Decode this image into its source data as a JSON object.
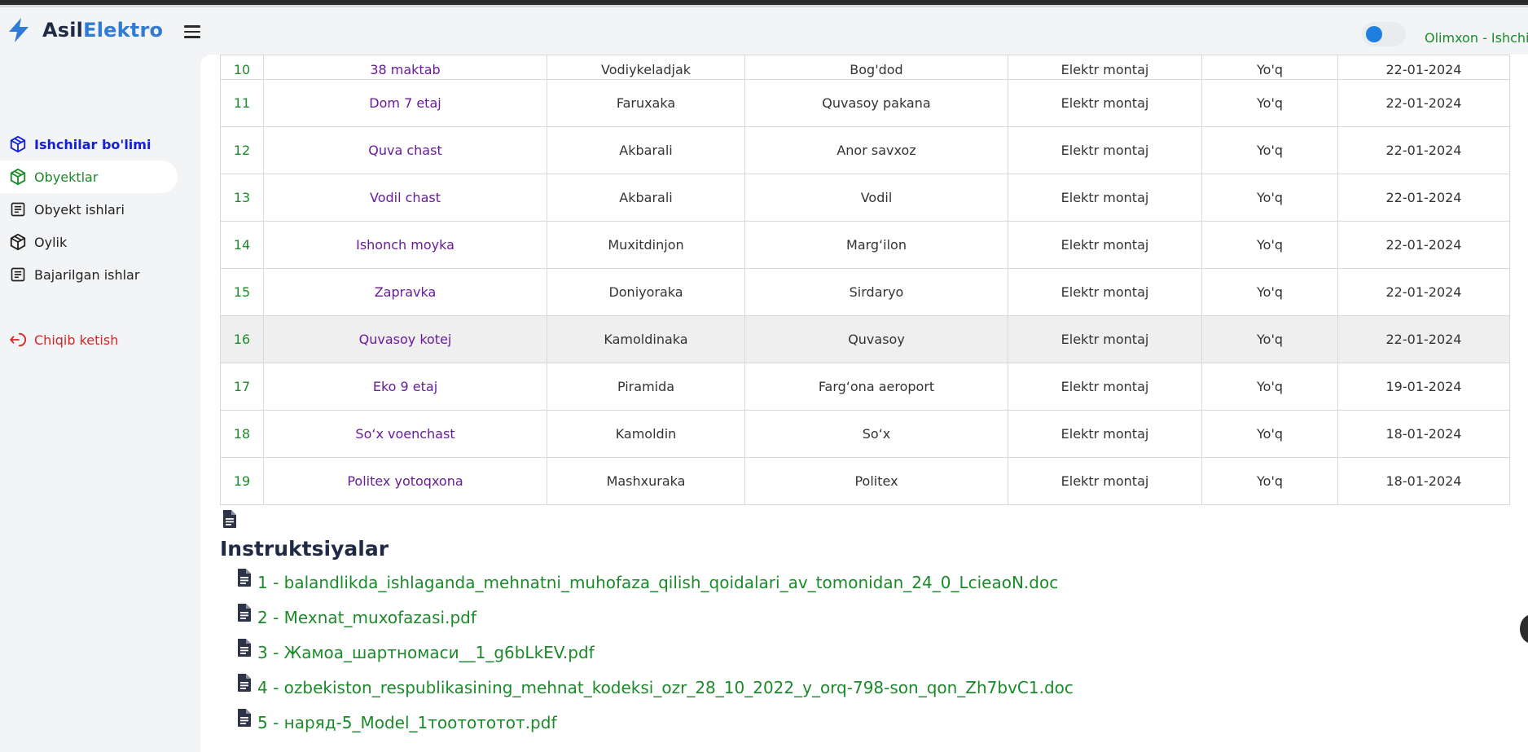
{
  "app": {
    "brand_part1": "Asil",
    "brand_part2": "Elektro"
  },
  "header": {
    "user_name": "Olimxon - Ishchi"
  },
  "sidebar": {
    "items": [
      {
        "label": "Ishchilar bo'limi",
        "icon": "box-icon"
      },
      {
        "label": "Obyektlar",
        "icon": "box-icon"
      },
      {
        "label": "Obyekt ishlari",
        "icon": "document-icon"
      },
      {
        "label": "Oylik",
        "icon": "box-icon"
      },
      {
        "label": "Bajarilgan ishlar",
        "icon": "document-icon"
      }
    ],
    "logout_label": "Chiqib ketish"
  },
  "table": {
    "rows": [
      {
        "num": "10",
        "name": "38 maktab",
        "worker": "Vodiykeladjak",
        "place": "Bog'dod",
        "type": "Elektr montaj",
        "status": "Yo'q",
        "date": "22-01-2024"
      },
      {
        "num": "11",
        "name": "Dom 7 etaj",
        "worker": "Faruxaka",
        "place": "Quvasoy pakana",
        "type": "Elektr montaj",
        "status": "Yo'q",
        "date": "22-01-2024"
      },
      {
        "num": "12",
        "name": "Quva chast",
        "worker": "Akbarali",
        "place": "Anor savxoz",
        "type": "Elektr montaj",
        "status": "Yo'q",
        "date": "22-01-2024"
      },
      {
        "num": "13",
        "name": "Vodil chast",
        "worker": "Akbarali",
        "place": "Vodil",
        "type": "Elektr montaj",
        "status": "Yo'q",
        "date": "22-01-2024"
      },
      {
        "num": "14",
        "name": "Ishonch moyka",
        "worker": "Muxitdinjon",
        "place": "Marg‘ilon",
        "type": "Elektr montaj",
        "status": "Yo'q",
        "date": "22-01-2024"
      },
      {
        "num": "15",
        "name": "Zapravka",
        "worker": "Doniyoraka",
        "place": "Sirdaryo",
        "type": "Elektr montaj",
        "status": "Yo'q",
        "date": "22-01-2024"
      },
      {
        "num": "16",
        "name": "Quvasoy kotej",
        "worker": "Kamoldinaka",
        "place": "Quvasoy",
        "type": "Elektr montaj",
        "status": "Yo'q",
        "date": "22-01-2024"
      },
      {
        "num": "17",
        "name": "Eko 9 etaj",
        "worker": "Piramida",
        "place": "Farg‘ona aeroport",
        "type": "Elektr montaj",
        "status": "Yo'q",
        "date": "19-01-2024"
      },
      {
        "num": "18",
        "name": "So‘x voenchast",
        "worker": "Kamoldin",
        "place": "So‘x",
        "type": "Elektr montaj",
        "status": "Yo'q",
        "date": "18-01-2024"
      },
      {
        "num": "19",
        "name": "Politex yotoqxona",
        "worker": "Mashxuraka",
        "place": "Politex",
        "type": "Elektr montaj",
        "status": "Yo'q",
        "date": "18-01-2024"
      }
    ]
  },
  "instructions": {
    "title": "Instruktsiyalar",
    "files": [
      "1 - balandlikda_ishlaganda_mehnatni_muhofaza_qilish_qoidalari_av_tomonidan_24_0_LcieaoN.doc",
      "2 - Mexnat_muxofazasi.pdf",
      "3 - Жамоа_шартномаси__1_g6bLkEV.pdf",
      "4 - ozbekiston_respublikasining_mehnat_kodeksi_ozr_28_10_2022_y_orq-798-son_qon_Zh7bvC1.doc",
      "5 - наряд-5_Model_1тоотототот.pdf"
    ]
  },
  "colors": {
    "accent_green": "#1b8a2a",
    "accent_blue": "#2f7bd6",
    "link_purple": "#6a1b9a",
    "logout_red": "#d42626"
  }
}
